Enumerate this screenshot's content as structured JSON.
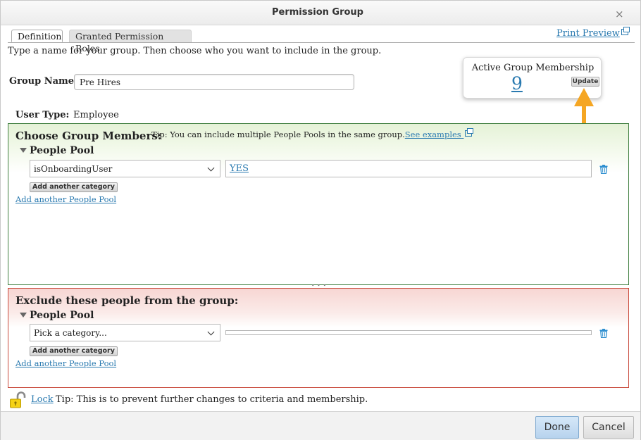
{
  "dialog": {
    "title": "Permission Group",
    "close_glyph": "×"
  },
  "tabs": [
    {
      "label": "Definition",
      "active": true
    },
    {
      "label": "Granted Permission Roles",
      "active": false
    }
  ],
  "print_preview": {
    "label": "Print Preview",
    "icon": "external-link-icon"
  },
  "instructions": "Type a name for your group. Then choose who you want to include in the group.",
  "group_name": {
    "label": "Group Name:",
    "value": "Pre Hires"
  },
  "membership": {
    "title": "Active Group Membership",
    "count": "9",
    "update_label": "Update"
  },
  "user_type": {
    "label": "User Type:",
    "value": "Employee"
  },
  "include": {
    "title": "Choose Group Members:",
    "tip": "Tip: You can include multiple People Pools in the same group.",
    "tip_link": "See examples",
    "pool_title": "People Pool",
    "category": "isOnboardingUser",
    "value": "YES",
    "add_category_label": "Add another category",
    "add_pool_label": "Add another People Pool"
  },
  "exclude": {
    "title": "Exclude these people from the group:",
    "pool_title": "People Pool",
    "category": "Pick a category...",
    "value": "",
    "add_category_label": "Add another category",
    "add_pool_label": "Add another People Pool"
  },
  "lock": {
    "label": "Lock",
    "tip": "Tip: This is to prevent further changes to criteria and membership."
  },
  "footer": {
    "done_label": "Done",
    "cancel_label": "Cancel"
  },
  "colors": {
    "link": "#2a7ab0",
    "include_border": "#3f7f3f",
    "exclude_border": "#c94a3c",
    "annotation_arrow": "#f5a623",
    "done_button": "#b7d3ee"
  }
}
